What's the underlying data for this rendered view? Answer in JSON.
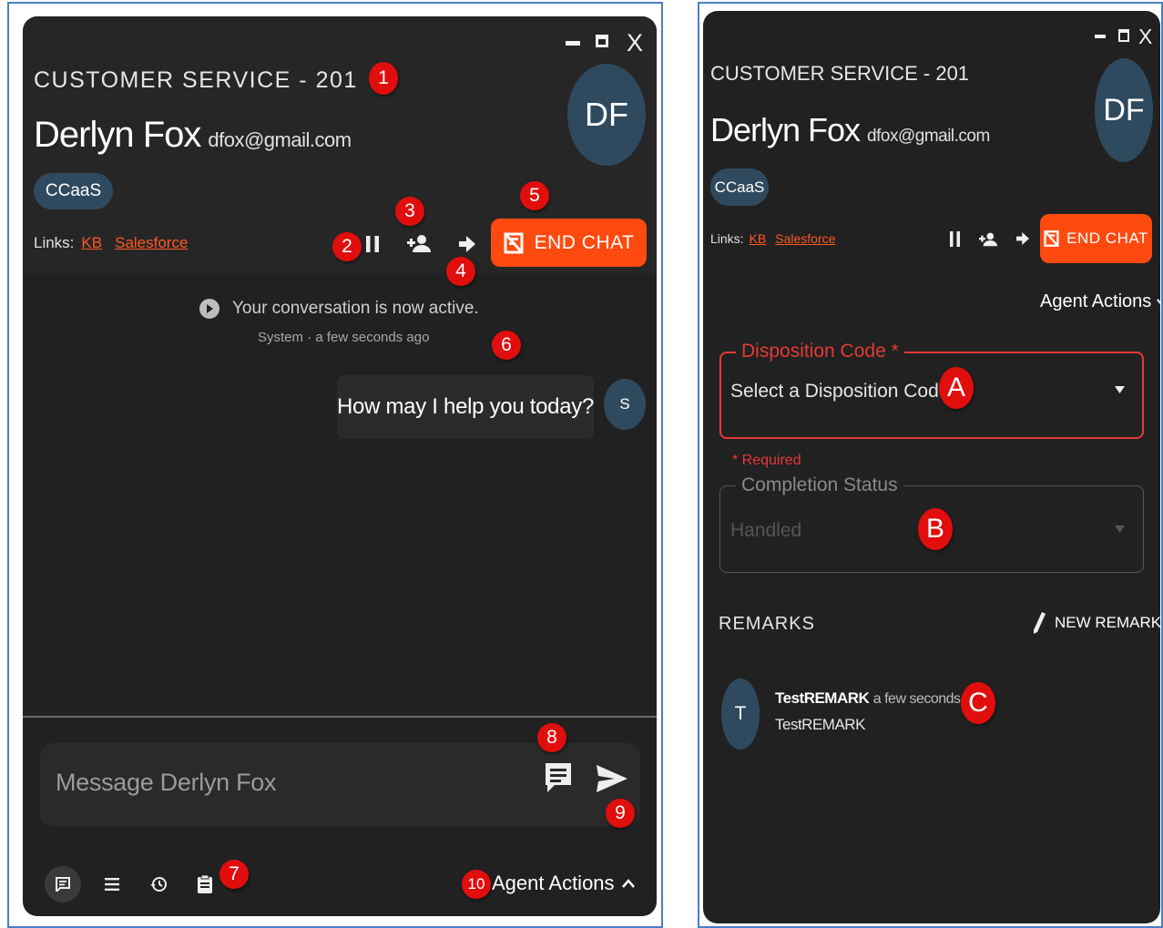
{
  "window_controls": {
    "minimize": "minimize",
    "maximize": "maximize",
    "close": "X"
  },
  "header": {
    "queue": "CUSTOMER SERVICE - 201",
    "customer_name": "Derlyn Fox",
    "customer_email": "dfox@gmail.com",
    "avatar_initials": "DF",
    "tag": "CCaaS",
    "links_label": "Links:",
    "links": [
      {
        "label": "KB"
      },
      {
        "label": "Salesforce"
      }
    ],
    "end_chat_label": "END CHAT"
  },
  "conversation": {
    "system_message": "Your conversation is now active.",
    "system_meta": "System · a few seconds ago",
    "agent_message": "How may I help you today?",
    "agent_avatar": "S"
  },
  "composer": {
    "placeholder": "Message Derlyn Fox"
  },
  "footer": {
    "agent_actions_label": "Agent Actions"
  },
  "agent_actions_panel": {
    "header_label": "Agent Actions",
    "disposition": {
      "label": "Disposition Code *",
      "placeholder": "Select a Disposition Code",
      "error": "* Required"
    },
    "completion": {
      "label": "Completion Status",
      "value": "Handled"
    },
    "remarks": {
      "title": "REMARKS",
      "new_remark_label": "NEW REMARK",
      "items": [
        {
          "avatar": "T",
          "author": "TestREMARK",
          "time": "a few seconds ago",
          "text": "TestREMARK"
        }
      ]
    }
  },
  "callouts": {
    "n1": "1",
    "n2": "2",
    "n3": "3",
    "n4": "4",
    "n5": "5",
    "n6": "6",
    "n7": "7",
    "n8": "8",
    "n9": "9",
    "n10": "10",
    "a": "A",
    "b": "B",
    "c": "C"
  },
  "colors": {
    "accent": "#ff4a0f",
    "panel": "#212121",
    "avatar": "#2f4a5e",
    "error": "#e53935",
    "callout": "#e10e0e",
    "frame": "#4a7fc1"
  }
}
